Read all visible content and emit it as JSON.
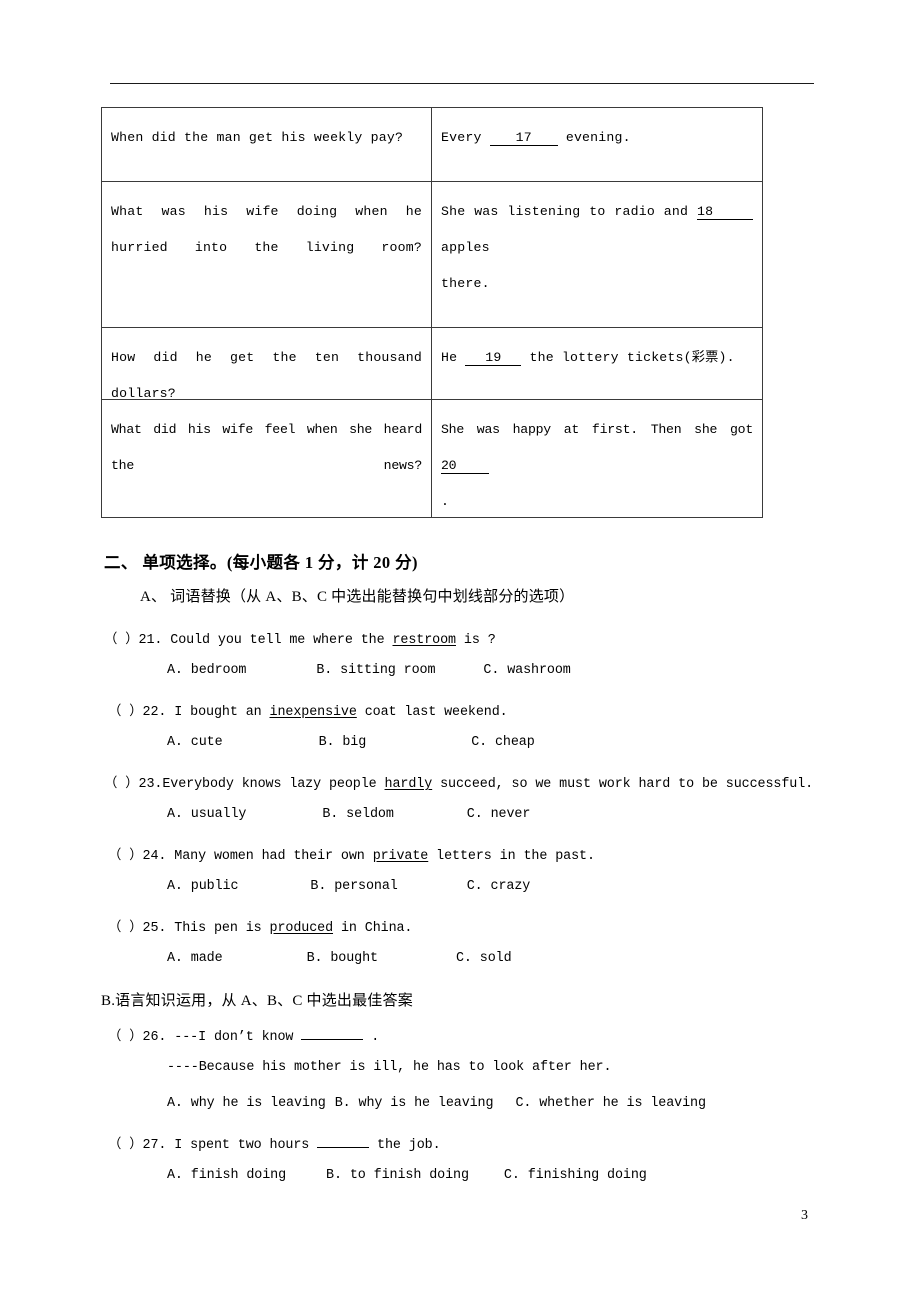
{
  "page": {
    "page_number": "3"
  },
  "qa_table": {
    "rows": [
      {
        "question": "When did the man get his weekly pay?",
        "answer_before": "Every",
        "blank_number": "17",
        "answer_after": "evening.",
        "answer_extra_lines": []
      },
      {
        "question": "What was his wife doing when he hurried into the living room?",
        "answer_before": "She was listening to radio and",
        "blank_number": "18",
        "answer_after": "",
        "answer_extra_lines": [
          "apples",
          "there."
        ]
      },
      {
        "question": "How did he get the ten thousand dollars?",
        "answer_before": "He",
        "blank_number": "19",
        "answer_after": "the lottery tickets(彩票).",
        "answer_extra_lines": []
      },
      {
        "question": "What did his wife feel when she heard the news?",
        "answer_before": "She was happy at first. Then she got",
        "blank_number": "20",
        "answer_after": "",
        "answer_extra_lines": [
          "."
        ]
      }
    ]
  },
  "section_two": {
    "heading": "二、 单项选择。(每小题各 1 分，计 20 分)",
    "part_a_heading": "A、 词语替换（从 A、B、C 中选出能替换句中划线部分的选项）",
    "part_b_heading": "B.语言知识运用，从 A、B、C 中选出最佳答案",
    "questions": [
      {
        "marker": "（ ）",
        "number": "21.",
        "stem_before": " Could you tell me where the ",
        "stem_underlined": "restroom",
        "stem_after": " is ?",
        "options": [
          "A. bedroom",
          "B. sitting room",
          "C. washroom"
        ]
      },
      {
        "marker": "（ ）",
        "number": "22.",
        "stem_before": " I bought an ",
        "stem_underlined": "inexpensive",
        "stem_after": " coat last weekend.",
        "options": [
          "A. cute",
          "B. big",
          "C. cheap"
        ]
      },
      {
        "marker": "（ ）",
        "number": "23.",
        "stem_before": "Everybody knows lazy people ",
        "stem_underlined": "hardly",
        "stem_after": " succeed, so we must work hard to be successful.",
        "options": [
          "A. usually",
          "B. seldom",
          "C. never"
        ]
      },
      {
        "marker": "（ ）",
        "number": "24.",
        "stem_before": " Many women had their own ",
        "stem_underlined": "private",
        "stem_after": " letters in the past.",
        "options": [
          "A. public",
          "B. personal",
          "C. crazy"
        ]
      },
      {
        "marker": "（ ）",
        "number": "25.",
        "stem_before": " This pen is ",
        "stem_underlined": "produced",
        "stem_after": " in China.",
        "options": [
          "A. made",
          "B. bought",
          "C. sold"
        ]
      },
      {
        "marker": "（ ）",
        "number": "26.",
        "stem_before": " ---I don’t know ",
        "stem_underlined": "",
        "stem_after": " .",
        "continuation": "----Because his mother is ill, he has to look after her.",
        "options": [
          "A. why he is leaving",
          "B. why is he leaving",
          "C. whether he is leaving"
        ]
      },
      {
        "marker": "（ ）",
        "number": "27.",
        "stem_before": " I spent two hours ",
        "stem_underlined": "",
        "stem_after": " the job.",
        "options": [
          "A. finish doing",
          "B. to finish doing",
          "C. finishing doing"
        ]
      }
    ]
  }
}
